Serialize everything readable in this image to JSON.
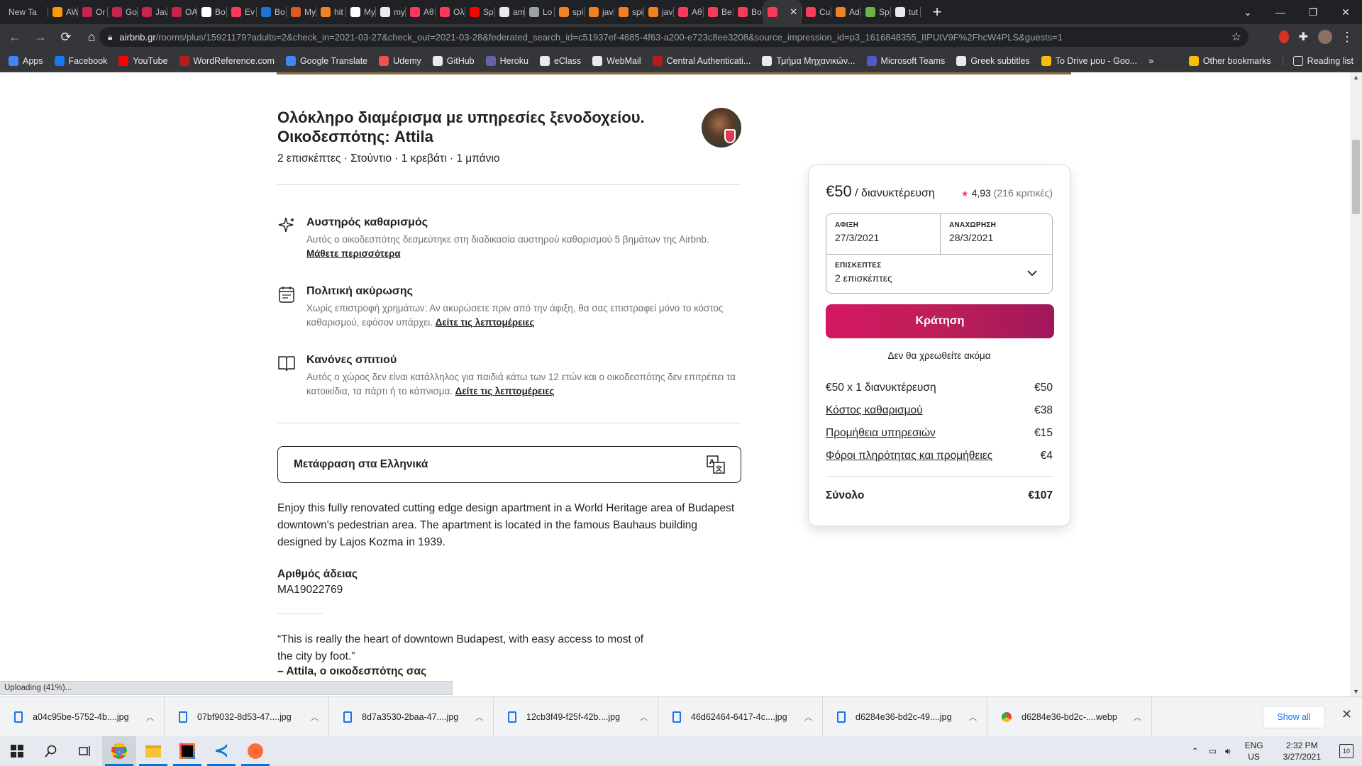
{
  "browser": {
    "tabs": [
      {
        "label": "New Ta",
        "fav_color": "#5f6368"
      },
      {
        "label": "AW",
        "fav_color": "#ff9900"
      },
      {
        "label": "Or",
        "fav_color": "#c7254e"
      },
      {
        "label": "Go",
        "fav_color": "#c7254e"
      },
      {
        "label": "Jav",
        "fav_color": "#c7254e"
      },
      {
        "label": "OA",
        "fav_color": "#c7254e"
      },
      {
        "label": "Bo",
        "fav_color": "#ffffff"
      },
      {
        "label": "Ev",
        "fav_color": "#ff385c"
      },
      {
        "label": "Bo",
        "fav_color": "#1976d2"
      },
      {
        "label": "My",
        "fav_color": "#e05a28"
      },
      {
        "label": "hit",
        "fav_color": "#f48024"
      },
      {
        "label": "My",
        "fav_color": "#ffffff"
      },
      {
        "label": "my",
        "fav_color": "#e8eaed"
      },
      {
        "label": "Αθ",
        "fav_color": "#ff385c"
      },
      {
        "label": "Ολ",
        "fav_color": "#ff385c"
      },
      {
        "label": "Sp",
        "fav_color": "#ff0000"
      },
      {
        "label": "am",
        "fav_color": "#e8eaed"
      },
      {
        "label": "Lo",
        "fav_color": "#9aa0a6"
      },
      {
        "label": "spi",
        "fav_color": "#f48024"
      },
      {
        "label": "jav",
        "fav_color": "#f48024"
      },
      {
        "label": "spi",
        "fav_color": "#f48024"
      },
      {
        "label": "jav",
        "fav_color": "#f48024"
      },
      {
        "label": "Αθ",
        "fav_color": "#ff385c"
      },
      {
        "label": "Be",
        "fav_color": "#ff385c"
      },
      {
        "label": "Βο",
        "fav_color": "#ff385c"
      },
      {
        "label": "",
        "fav_color": "#ff385c",
        "active": true
      },
      {
        "label": "Cu",
        "fav_color": "#ff385c"
      },
      {
        "label": "Ad",
        "fav_color": "#f48024"
      },
      {
        "label": "Sp",
        "fav_color": "#6db33f"
      },
      {
        "label": "tut",
        "fav_color": "#e8eaed"
      }
    ],
    "url_host": "airbnb.gr",
    "url_path": "/rooms/plus/15921179?adults=2&check_in=2021-03-27&check_out=2021-03-28&federated_search_id=c51937ef-4685-4f63-a200-e723c8ee3208&source_impression_id=p3_1616848355_IIPUtV9F%2FhcW4PLS&guests=1",
    "bookmarks": [
      {
        "label": "Apps",
        "color": "#4285f4"
      },
      {
        "label": "Facebook",
        "color": "#1877f2"
      },
      {
        "label": "YouTube",
        "color": "#ff0000"
      },
      {
        "label": "WordReference.com",
        "color": "#b71c1c"
      },
      {
        "label": "Google Translate",
        "color": "#4285f4"
      },
      {
        "label": "Udemy",
        "color": "#ec5252"
      },
      {
        "label": "GitHub",
        "color": "#e8eaed"
      },
      {
        "label": "Heroku",
        "color": "#6762a6"
      },
      {
        "label": "eClass",
        "color": "#e8eaed"
      },
      {
        "label": "WebMail",
        "color": "#e8eaed"
      },
      {
        "label": "Central Authenticati...",
        "color": "#b71c1c"
      },
      {
        "label": "Τμήμα Μηχανικών...",
        "color": "#e8eaed"
      },
      {
        "label": "Microsoft Teams",
        "color": "#5059c9"
      },
      {
        "label": "Greek subtitles",
        "color": "#e8eaed"
      },
      {
        "label": "To Drive μου - Goo...",
        "color": "#fbbc04"
      }
    ],
    "bookmarks_more": "»",
    "other_bookmarks": "Other bookmarks",
    "reading_list": "Reading list"
  },
  "listing": {
    "title": "Ολόκληρο διαμέρισμα με υπηρεσίες ξενοδοχείου. Οικοδεσπότης: Attila",
    "subtitle": "2 επισκέπτες · Στούντιο · 1 κρεβάτι · 1 μπάνιο",
    "features": [
      {
        "icon": "sparkle-icon",
        "title": "Αυστηρός καθαρισμός",
        "desc": "Αυτός ο οικοδεσπότης δεσμεύτηκε στη διαδικασία αυστηρού καθαρισμού 5 βημάτων της Airbnb.",
        "link": "Μάθετε περισσότερα"
      },
      {
        "icon": "calendar-icon",
        "title": "Πολιτική ακύρωσης",
        "desc": "Χωρίς επιστροφή χρημάτων: Αν ακυρώσετε πριν από την άφιξη, θα σας επιστραφεί μόνο το κόστος καθαρισμού, εφόσον υπάρχει.",
        "link": "Δείτε τις λεπτομέρειες"
      },
      {
        "icon": "book-icon",
        "title": "Κανόνες σπιτιού",
        "desc": "Αυτός ο χώρος δεν είναι κατάλληλος για παιδιά κάτω των 12 ετών και ο οικοδεσπότης δεν επιτρέπει τα κατοικίδια, τα πάρτι ή το κάπνισμα.",
        "link": "Δείτε τις λεπτομέρειες"
      }
    ],
    "translate_label": "Μετάφραση στα Ελληνικά",
    "description": "Enjoy this fully renovated cutting edge design apartment in a World Heritage area of Budapest downtown's pedestrian area. The apartment is located in the famous Bauhaus building designed by Lajos Kozma in 1939.",
    "license_title": "Αριθμός άδειας",
    "license_number": "MA19022769",
    "quote": "“This is really the heart of downtown Budapest, with easy access to most of the city by foot.”",
    "quote_author": "– Attila, ο οικοδεσπότης σας"
  },
  "booking": {
    "price": "€50",
    "per_night": " / διανυκτέρευση",
    "rating_star": "★",
    "rating": "4,93",
    "reviews": "(216 κριτικές)",
    "checkin_label": "ΑΦΙΞΗ",
    "checkin_value": "27/3/2021",
    "checkout_label": "ΑΝΑΧΩΡΗΣΗ",
    "checkout_value": "28/3/2021",
    "guests_label": "ΕΠΙΣΚΕΠΤΕΣ",
    "guests_value": "2 επισκέπτες",
    "reserve_label": "Κράτηση",
    "no_charge": "Δεν θα χρεωθείτε ακόμα",
    "lines": [
      {
        "label": "€50 x 1 διανυκτέρευση",
        "amount": "€50",
        "link": false
      },
      {
        "label": "Κόστος καθαρισμού",
        "amount": "€38",
        "link": true
      },
      {
        "label": "Προμήθεια υπηρεσιών",
        "amount": "€15",
        "link": true
      },
      {
        "label": "Φόροι πληρότητας και προμήθειες",
        "amount": "€4",
        "link": true
      }
    ],
    "total_label": "Σύνολο",
    "total_amount": "€107",
    "brand_color": "#e31c5f"
  },
  "status_text": "Uploading (41%)...",
  "downloads": [
    {
      "name": "a04c95be-5752-4b....jpg",
      "type": "file"
    },
    {
      "name": "07bf9032-8d53-47....jpg",
      "type": "file"
    },
    {
      "name": "8d7a3530-2baa-47....jpg",
      "type": "file"
    },
    {
      "name": "12cb3f49-f25f-42b....jpg",
      "type": "file"
    },
    {
      "name": "46d62464-6417-4c....jpg",
      "type": "file"
    },
    {
      "name": "d6284e36-bd2c-49....jpg",
      "type": "file"
    },
    {
      "name": "d6284e36-bd2c-....webp",
      "type": "chrome"
    }
  ],
  "show_all": "Show all",
  "taskbar": {
    "lang1": "ENG",
    "lang2": "US",
    "time": "2:32 PM",
    "date": "3/27/2021",
    "notif_count": "10"
  }
}
